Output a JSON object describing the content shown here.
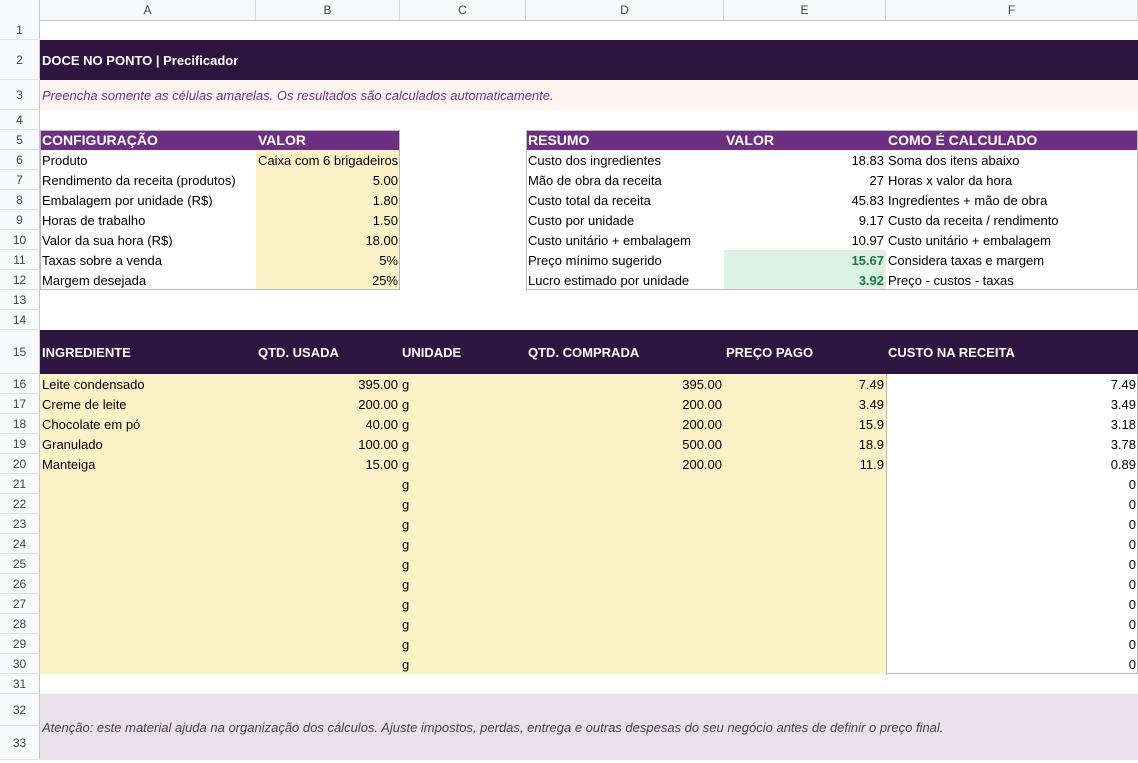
{
  "columns": [
    "A",
    "B",
    "C",
    "D",
    "E",
    "F"
  ],
  "rows": [
    "1",
    "2",
    "3",
    "4",
    "5",
    "6",
    "7",
    "8",
    "9",
    "10",
    "11",
    "12",
    "13",
    "14",
    "15",
    "16",
    "17",
    "18",
    "19",
    "20",
    "21",
    "22",
    "23",
    "24",
    "25",
    "26",
    "27",
    "28",
    "29",
    "30",
    "31",
    "32",
    "33"
  ],
  "title": "DOCE NO PONTO | Precificador",
  "instructions": "Preencha somente as células amarelas. Os resultados são calculados automaticamente.",
  "config": {
    "header_label": "CONFIGURAÇÃO",
    "header_value": "VALOR",
    "items": [
      {
        "label": "Produto",
        "value": "Caixa com 6 brigadeiros"
      },
      {
        "label": "Rendimento da receita (produtos)",
        "value": "5.00"
      },
      {
        "label": "Embalagem por unidade (R$)",
        "value": "1.80"
      },
      {
        "label": "Horas de trabalho",
        "value": "1.50"
      },
      {
        "label": "Valor da sua hora (R$)",
        "value": "18.00"
      },
      {
        "label": "Taxas sobre a venda",
        "value": "5%"
      },
      {
        "label": "Margem desejada",
        "value": "25%"
      }
    ]
  },
  "summary": {
    "header_label": "RESUMO",
    "header_value": "VALOR",
    "header_how": "COMO É CALCULADO",
    "items": [
      {
        "label": "Custo dos ingredientes",
        "value": "18.83",
        "how": "Soma dos itens abaixo"
      },
      {
        "label": "Mão de obra da receita",
        "value": "27",
        "how": "Horas x valor da hora"
      },
      {
        "label": "Custo total da receita",
        "value": "45.83",
        "how": "Ingredientes + mão de obra"
      },
      {
        "label": "Custo por unidade",
        "value": "9.17",
        "how": "Custo da receita / rendimento"
      },
      {
        "label": "Custo unitário + embalagem",
        "value": "10.97",
        "how": "Custo unitário + embalagem"
      },
      {
        "label": "Preço mínimo sugerido",
        "value": "15.67",
        "how": "Considera taxas e margem"
      },
      {
        "label": "Lucro estimado por unidade",
        "value": "3.92",
        "how": "Preço - custos - taxas"
      }
    ]
  },
  "ingredients": {
    "headers": [
      "INGREDIENTE",
      "QTD. USADA",
      "UNIDADE",
      "QTD. COMPRADA",
      "PREÇO PAGO",
      "CUSTO NA RECEITA"
    ],
    "rows": [
      {
        "name": "Leite condensado",
        "qty": "395.00",
        "unit": "g",
        "bought": "395.00",
        "price": "7.49",
        "cost": "7.49"
      },
      {
        "name": "Creme de leite",
        "qty": "200.00",
        "unit": "g",
        "bought": "200.00",
        "price": "3.49",
        "cost": "3.49"
      },
      {
        "name": "Chocolate em pó",
        "qty": "40.00",
        "unit": "g",
        "bought": "200.00",
        "price": "15.9",
        "cost": "3.18"
      },
      {
        "name": "Granulado",
        "qty": "100.00",
        "unit": "g",
        "bought": "500.00",
        "price": "18.9",
        "cost": "3.78"
      },
      {
        "name": "Manteiga",
        "qty": "15.00",
        "unit": "g",
        "bought": "200.00",
        "price": "11.9",
        "cost": "0.89"
      },
      {
        "name": "",
        "qty": "",
        "unit": "g",
        "bought": "",
        "price": "",
        "cost": "0"
      },
      {
        "name": "",
        "qty": "",
        "unit": "g",
        "bought": "",
        "price": "",
        "cost": "0"
      },
      {
        "name": "",
        "qty": "",
        "unit": "g",
        "bought": "",
        "price": "",
        "cost": "0"
      },
      {
        "name": "",
        "qty": "",
        "unit": "g",
        "bought": "",
        "price": "",
        "cost": "0"
      },
      {
        "name": "",
        "qty": "",
        "unit": "g",
        "bought": "",
        "price": "",
        "cost": "0"
      },
      {
        "name": "",
        "qty": "",
        "unit": "g",
        "bought": "",
        "price": "",
        "cost": "0"
      },
      {
        "name": "",
        "qty": "",
        "unit": "g",
        "bought": "",
        "price": "",
        "cost": "0"
      },
      {
        "name": "",
        "qty": "",
        "unit": "g",
        "bought": "",
        "price": "",
        "cost": "0"
      },
      {
        "name": "",
        "qty": "",
        "unit": "g",
        "bought": "",
        "price": "",
        "cost": "0"
      },
      {
        "name": "",
        "qty": "",
        "unit": "g",
        "bought": "",
        "price": "",
        "cost": "0"
      }
    ]
  },
  "footer_note": "Atenção: este material ajuda na organização dos cálculos. Ajuste impostos, perdas, entrega e outras despesas do seu negócio antes de definir o preço final.",
  "colors": {
    "title_bg": "#2d1540",
    "section_header_bg": "#6e2f83",
    "input_yellow": "#fdf1c7",
    "result_green": "#dcf3e3",
    "note_bg": "#e8e1ea",
    "instructions_bg": "#fdf5ef"
  }
}
